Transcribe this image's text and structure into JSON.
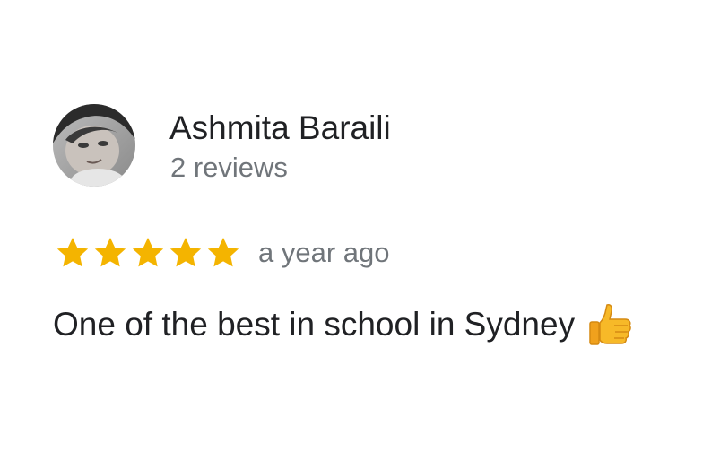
{
  "review": {
    "reviewer_name": "Ashmita Baraili",
    "review_count": "2 reviews",
    "rating": 5,
    "max_rating": 5,
    "time": "a year ago",
    "text": "One of the best in school in Sydney",
    "emoji_icon": "thumbs-up-icon"
  },
  "colors": {
    "star": "#f4b400",
    "name": "#202124",
    "secondary": "#70757a"
  }
}
